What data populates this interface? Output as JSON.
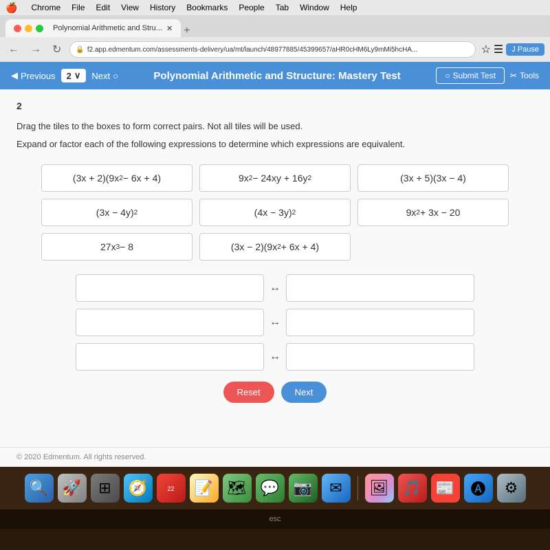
{
  "menubar": {
    "apple": "🍎",
    "items": [
      "Chrome",
      "File",
      "Edit",
      "View",
      "History",
      "Bookmarks",
      "People",
      "Tab",
      "Window",
      "Help"
    ]
  },
  "browser": {
    "tab_title": "Polynomial Arithmetic and Stru...",
    "tab_new": "+",
    "url": "f2.app.edmentum.com/assessments-delivery/ua/mt/launch/48977885/45399657/aHR0cHM6Ly9mMi5hcHA...",
    "pause_btn": "J Pause"
  },
  "question_nav": {
    "prev_label": "Previous",
    "question_number": "2",
    "chevron": "∨",
    "next_label": "Next",
    "next_icon": "○",
    "page_title": "Polynomial Arithmetic and Structure: Mastery Test",
    "submit_label": "Submit Test",
    "submit_icon": "○",
    "tools_label": "Tools",
    "tools_icon": "✂"
  },
  "content": {
    "question_number": "2",
    "instruction1": "Drag the tiles to the boxes to form correct pairs. Not all tiles will be used.",
    "instruction2": "Expand or factor each of the following expressions to determine which expressions are equivalent.",
    "tiles": [
      "(3x + 2)(9x² − 6x + 4)",
      "9x² − 24xy + 16y²",
      "(3x + 5)(3x − 4)",
      "(3x − 4y)²",
      "(4x − 3y)²",
      "9x² + 3x − 20",
      "27x³ − 8",
      "(3x − 2)(9x² + 6x + 4)"
    ]
  },
  "buttons": {
    "reset": "Reset",
    "next": "Next"
  },
  "footer": {
    "copyright": "© 2020 Edmentum. All rights reserved."
  },
  "dock": {
    "items": [
      "🔍",
      "🚀",
      "⊞",
      "🧭",
      "📅",
      "📝",
      "🗺",
      "💬",
      "📷",
      "✉",
      "🖼",
      "🎵",
      "📰",
      "🅐",
      "⚙"
    ]
  }
}
